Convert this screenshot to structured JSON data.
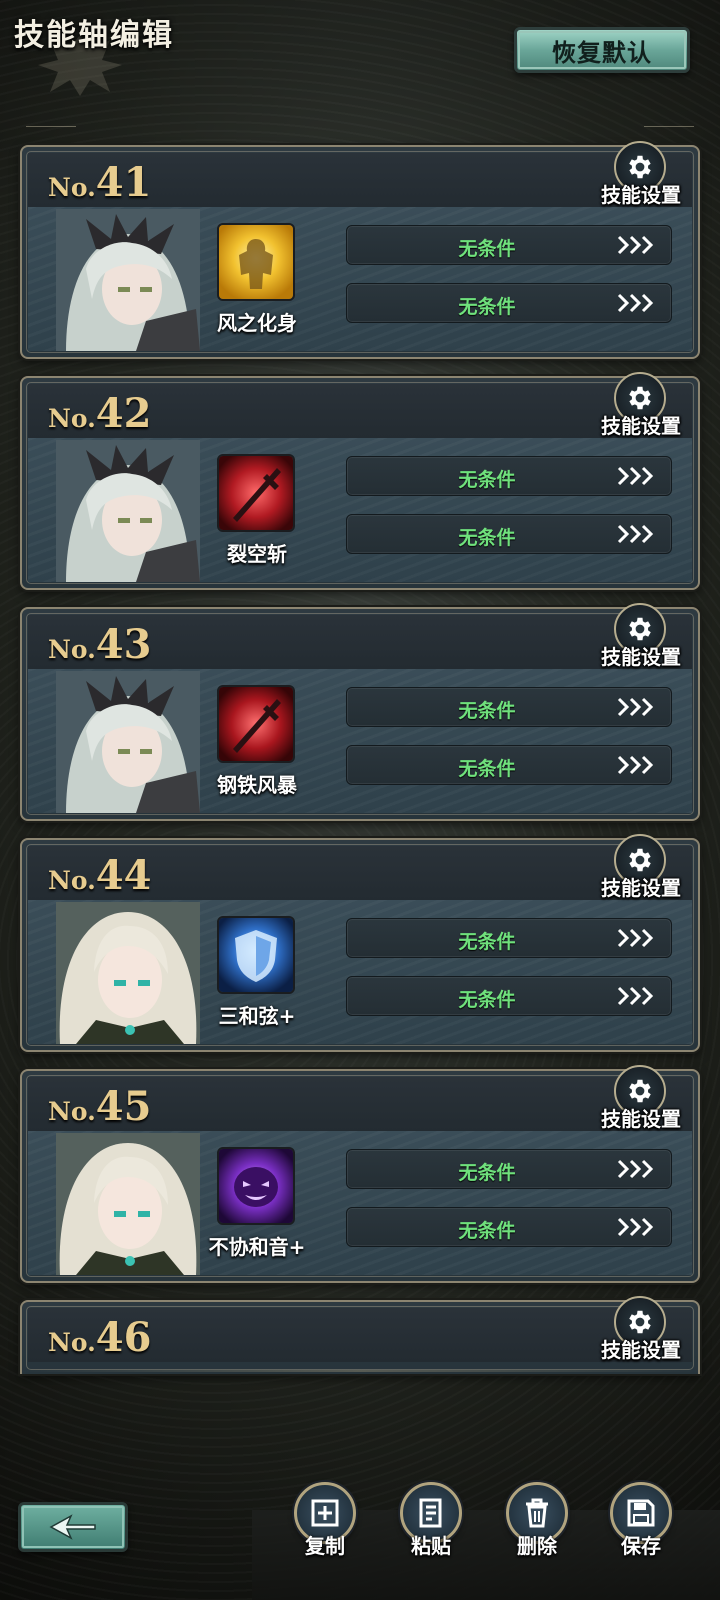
{
  "header": {
    "title": "技能轴编辑",
    "reset_label": "恢复默认"
  },
  "settings_label": "技能设置",
  "no_prefix": "No.",
  "cards": [
    {
      "number": "41",
      "skill_name": "风之化身",
      "skill_icon": "wind-avatar-icon",
      "conditions": [
        "无条件",
        "无条件"
      ]
    },
    {
      "number": "42",
      "skill_name": "裂空斩",
      "skill_icon": "sky-rending-slash-icon",
      "conditions": [
        "无条件",
        "无条件"
      ]
    },
    {
      "number": "43",
      "skill_name": "钢铁风暴",
      "skill_icon": "steel-storm-icon",
      "conditions": [
        "无条件",
        "无条件"
      ]
    },
    {
      "number": "44",
      "skill_name": "三和弦+",
      "skill_icon": "shield-icon",
      "conditions": [
        "无条件",
        "无条件"
      ]
    },
    {
      "number": "45",
      "skill_name": "不协和音+",
      "skill_icon": "dissonance-icon",
      "conditions": [
        "无条件",
        "无条件"
      ]
    },
    {
      "number": "46"
    }
  ],
  "footer": {
    "copy_label": "复制",
    "paste_label": "粘贴",
    "delete_label": "删除",
    "save_label": "保存"
  },
  "colors": {
    "condition_text": "#6fe17c",
    "number_gold": "#e7cc8f",
    "accent_teal": "#6aa699"
  }
}
